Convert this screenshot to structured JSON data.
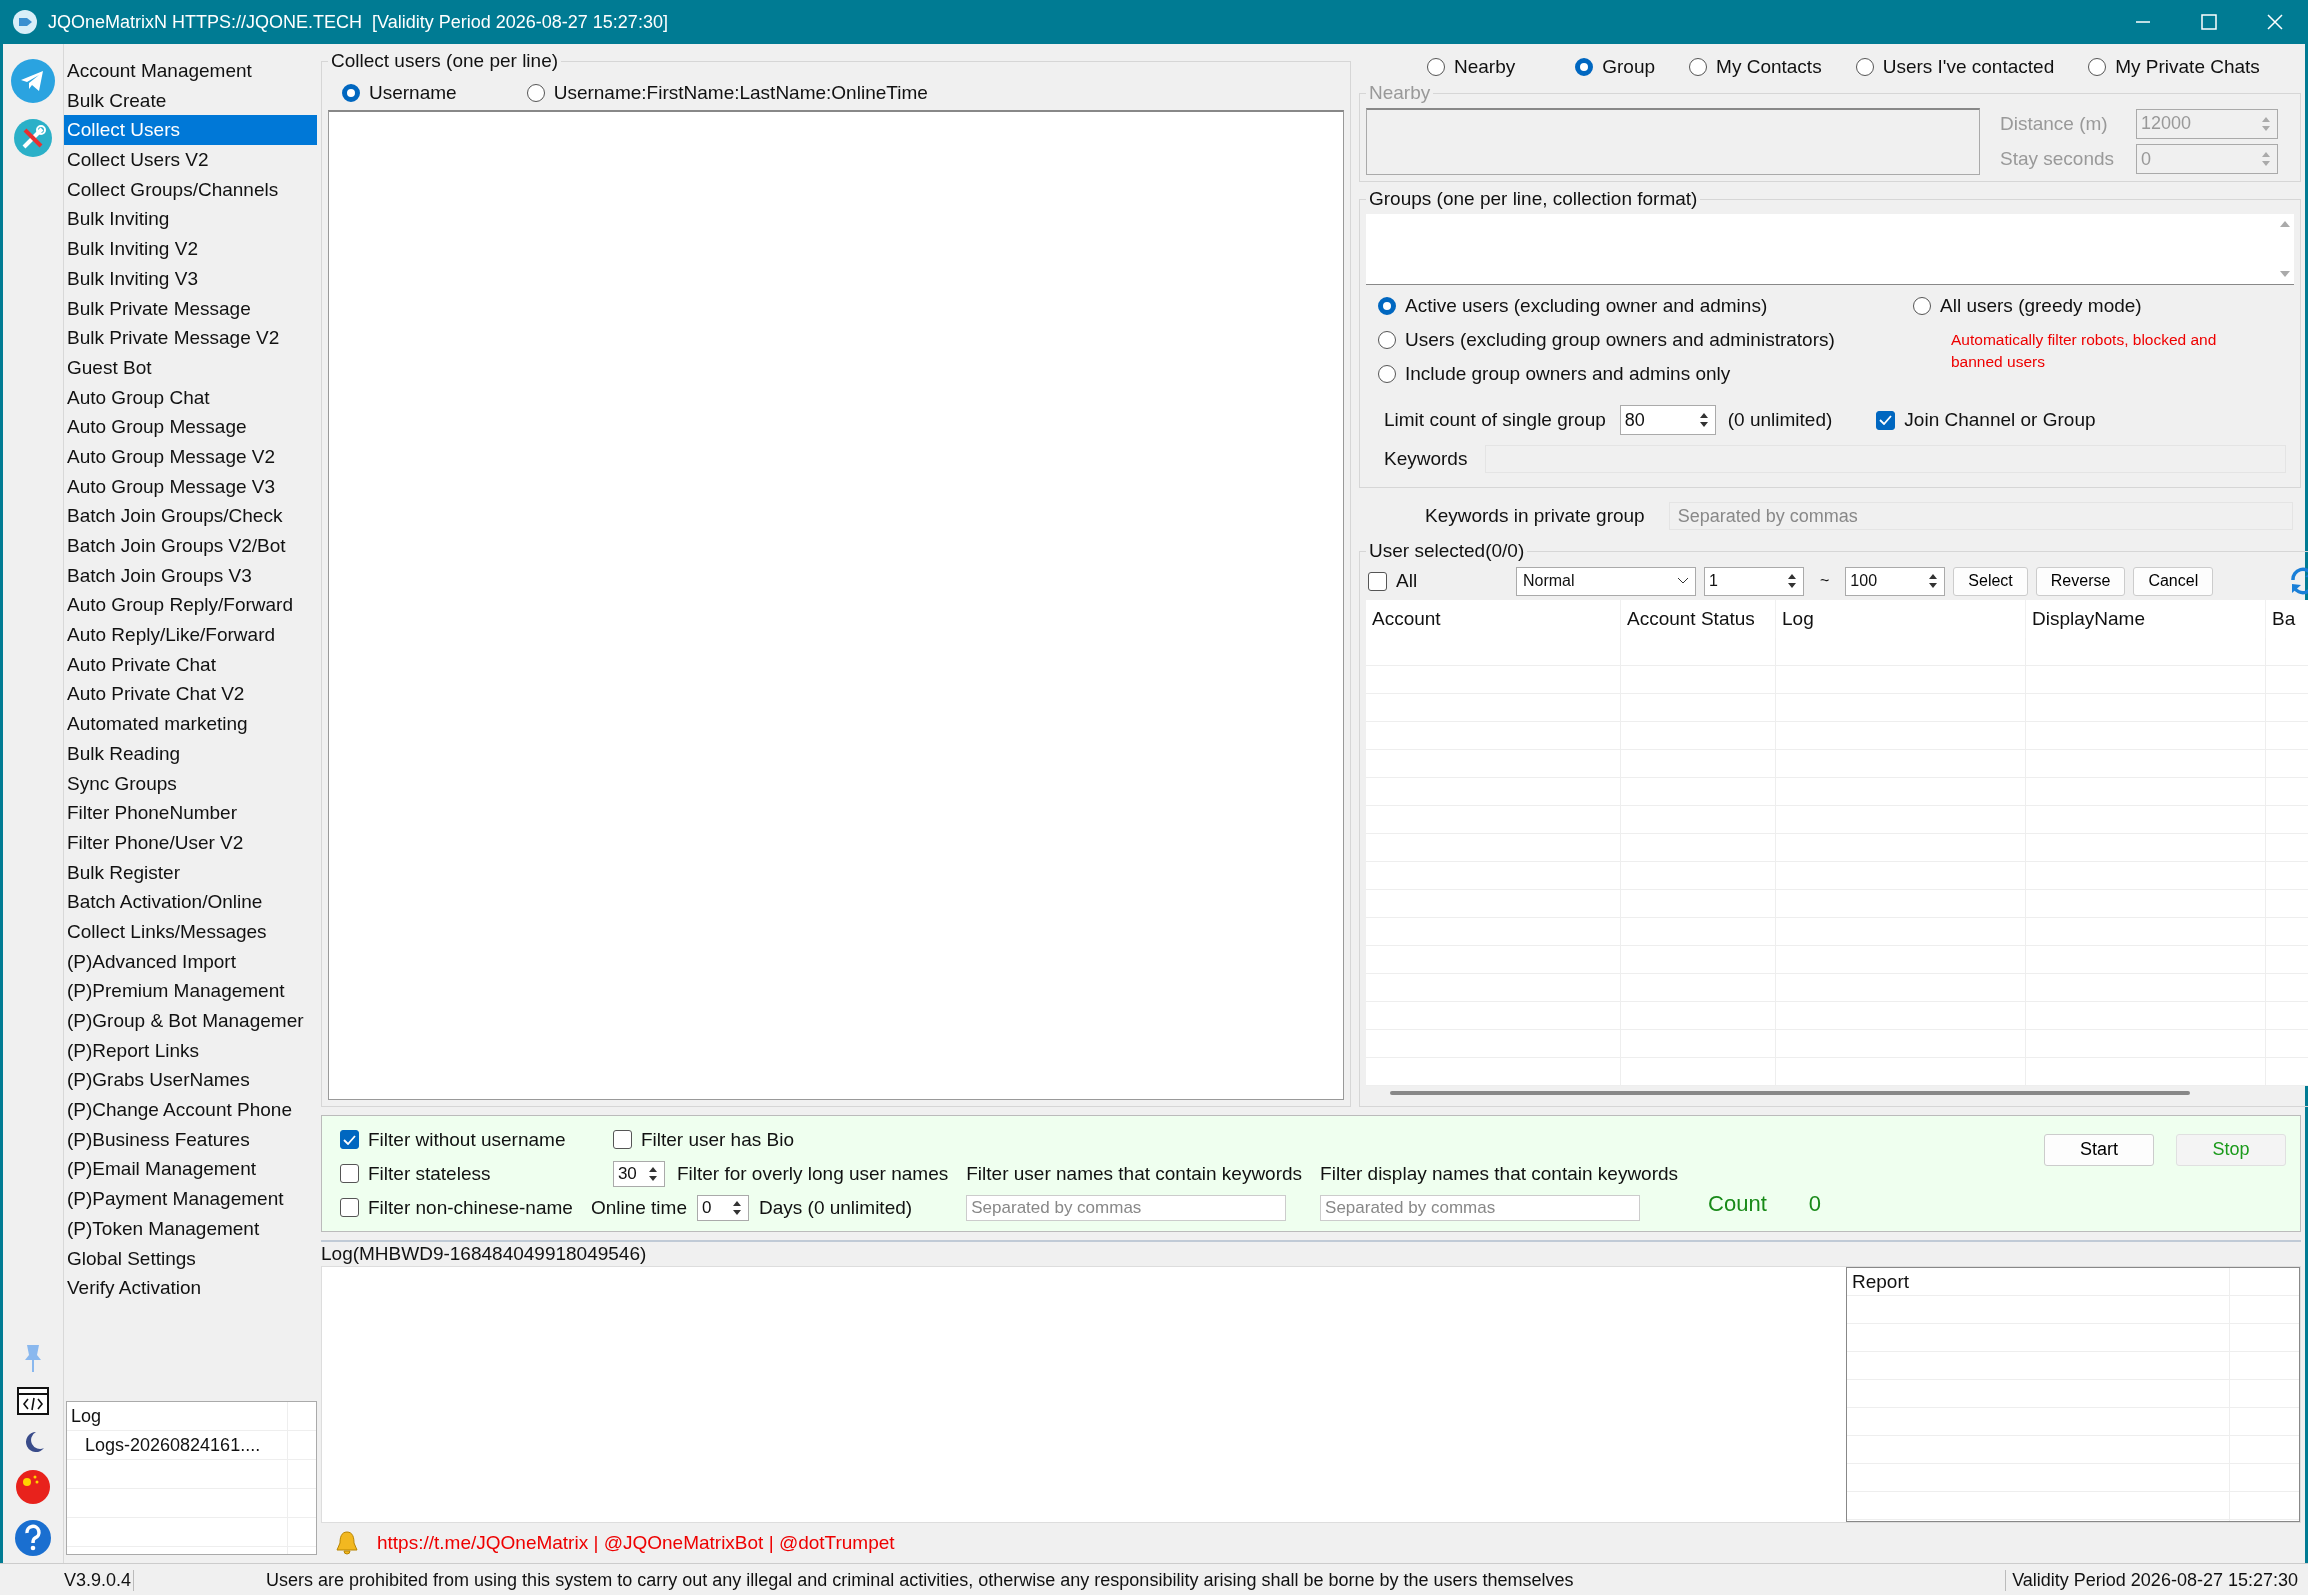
{
  "window": {
    "title": "JQOneMatrixN HTTPS://JQONE.TECH  [Validity Period 2026-08-27 15:27:30]"
  },
  "sidebar": {
    "items": [
      {
        "label": "Account Management",
        "selected": false
      },
      {
        "label": "Bulk Create",
        "selected": false
      },
      {
        "label": "Collect Users",
        "selected": true
      },
      {
        "label": "Collect Users V2",
        "selected": false
      },
      {
        "label": "Collect Groups/Channels",
        "selected": false
      },
      {
        "label": "Bulk Inviting",
        "selected": false
      },
      {
        "label": "Bulk Inviting V2",
        "selected": false
      },
      {
        "label": "Bulk Inviting V3",
        "selected": false
      },
      {
        "label": "Bulk Private Message",
        "selected": false
      },
      {
        "label": "Bulk Private Message V2",
        "selected": false
      },
      {
        "label": "Guest Bot",
        "selected": false
      },
      {
        "label": "Auto Group Chat",
        "selected": false
      },
      {
        "label": "Auto Group Message",
        "selected": false
      },
      {
        "label": "Auto Group Message V2",
        "selected": false
      },
      {
        "label": "Auto Group Message V3",
        "selected": false
      },
      {
        "label": "Batch Join Groups/Check",
        "selected": false
      },
      {
        "label": "Batch Join Groups V2/Bot",
        "selected": false
      },
      {
        "label": "Batch Join Groups V3",
        "selected": false
      },
      {
        "label": "Auto Group Reply/Forward",
        "selected": false
      },
      {
        "label": "Auto Reply/Like/Forward",
        "selected": false
      },
      {
        "label": "Auto Private Chat",
        "selected": false
      },
      {
        "label": "Auto Private Chat V2",
        "selected": false
      },
      {
        "label": "Automated marketing",
        "selected": false
      },
      {
        "label": "Bulk Reading",
        "selected": false
      },
      {
        "label": "Sync Groups",
        "selected": false
      },
      {
        "label": "Filter PhoneNumber",
        "selected": false
      },
      {
        "label": "Filter Phone/User V2",
        "selected": false
      },
      {
        "label": "Bulk Register",
        "selected": false
      },
      {
        "label": "Batch Activation/Online",
        "selected": false
      },
      {
        "label": "Collect Links/Messages",
        "selected": false
      },
      {
        "label": "(P)Advanced Import",
        "selected": false
      },
      {
        "label": "(P)Premium Management",
        "selected": false
      },
      {
        "label": "(P)Group & Bot Managemer",
        "selected": false
      },
      {
        "label": "(P)Report Links",
        "selected": false
      },
      {
        "label": "(P)Grabs UserNames",
        "selected": false
      },
      {
        "label": "(P)Change Account Phone",
        "selected": false
      },
      {
        "label": "(P)Business Features",
        "selected": false
      },
      {
        "label": "(P)Email Management",
        "selected": false
      },
      {
        "label": "(P)Payment Management",
        "selected": false
      },
      {
        "label": "(P)Token Management",
        "selected": false
      },
      {
        "label": "Global Settings",
        "selected": false
      },
      {
        "label": "Verify Activation",
        "selected": false
      }
    ]
  },
  "log_panel": {
    "header": "Log",
    "items": [
      "Logs-20260824161...."
    ]
  },
  "collect": {
    "title": "Collect users (one per line)",
    "formats": [
      {
        "label": "Username",
        "selected": true
      },
      {
        "label": "Username:FirstName:LastName:OnlineTime",
        "selected": false
      }
    ]
  },
  "sources": [
    {
      "label": "Nearby",
      "selected": false
    },
    {
      "label": "Group",
      "selected": true
    },
    {
      "label": "My Contacts",
      "selected": false
    },
    {
      "label": "Users I've contacted",
      "selected": false
    },
    {
      "label": "My Private Chats",
      "selected": false
    }
  ],
  "nearby": {
    "title": "Nearby",
    "disabled": true,
    "fields": [
      {
        "label": "Distance (m)",
        "value": "12000"
      },
      {
        "label": "Stay seconds",
        "value": "0"
      }
    ]
  },
  "groups": {
    "title": "Groups (one per line, collection format)",
    "modes": [
      {
        "label": "Active users (excluding owner and admins)",
        "selected": true
      },
      {
        "label": "Users (excluding group owners and administrators)",
        "selected": false
      },
      {
        "label": "Include group owners and admins only",
        "selected": false
      },
      {
        "label": "All users (greedy mode)",
        "selected": false
      }
    ],
    "note": "Automatically filter robots, blocked and banned users",
    "limit": {
      "label": "Limit count of single group",
      "value": "80",
      "hint": "(0 unlimited)"
    },
    "join": {
      "label": "Join Channel or Group",
      "checked": true
    },
    "keywords": {
      "label": "Keywords"
    }
  },
  "private_keywords": {
    "label": "Keywords in private group",
    "placeholder": "Separated by commas"
  },
  "users": {
    "title": "User selected(0/0)",
    "all": {
      "label": "All",
      "checked": false
    },
    "mode": "Normal",
    "from": "1",
    "separator": "~",
    "to": "100",
    "buttons": [
      "Select",
      "Reverse",
      "Cancel"
    ],
    "columns": [
      "Account",
      "Account Status",
      "Log",
      "DisplayName",
      "Ba"
    ]
  },
  "filters": {
    "checks": [
      {
        "label": "Filter without username",
        "checked": true
      },
      {
        "label": "Filter user has Bio",
        "checked": false
      },
      {
        "label": "Filter stateless",
        "checked": false
      },
      {
        "label": "Filter non-chinese-name",
        "checked": false
      }
    ],
    "long_name": {
      "value": "30",
      "label": "Filter for overly long user names"
    },
    "online": {
      "label": "Online time",
      "value": "0",
      "hint": "Days (0 unlimited)"
    },
    "name_keywords": {
      "label": "Filter user names that contain keywords",
      "placeholder": "Separated by commas"
    },
    "display_keywords": {
      "label": "Filter display names that contain keywords",
      "placeholder": "Separated by commas"
    },
    "start": "Start",
    "stop": "Stop",
    "count_label": "Count",
    "count": "0"
  },
  "log": {
    "title": "Log(MHBWD9-168484049918049546)",
    "report": "Report"
  },
  "links": "https://t.me/JQOneMatrix | @JQOneMatrixBot | @dotTrumpet",
  "status": {
    "version": "V3.9.0.4",
    "notice": "Users are prohibited from using this system to carry out any illegal and criminal activities, otherwise any responsibility arising shall be borne by the users themselves",
    "validity": "Validity Period 2026-08-27 15:27:30"
  }
}
